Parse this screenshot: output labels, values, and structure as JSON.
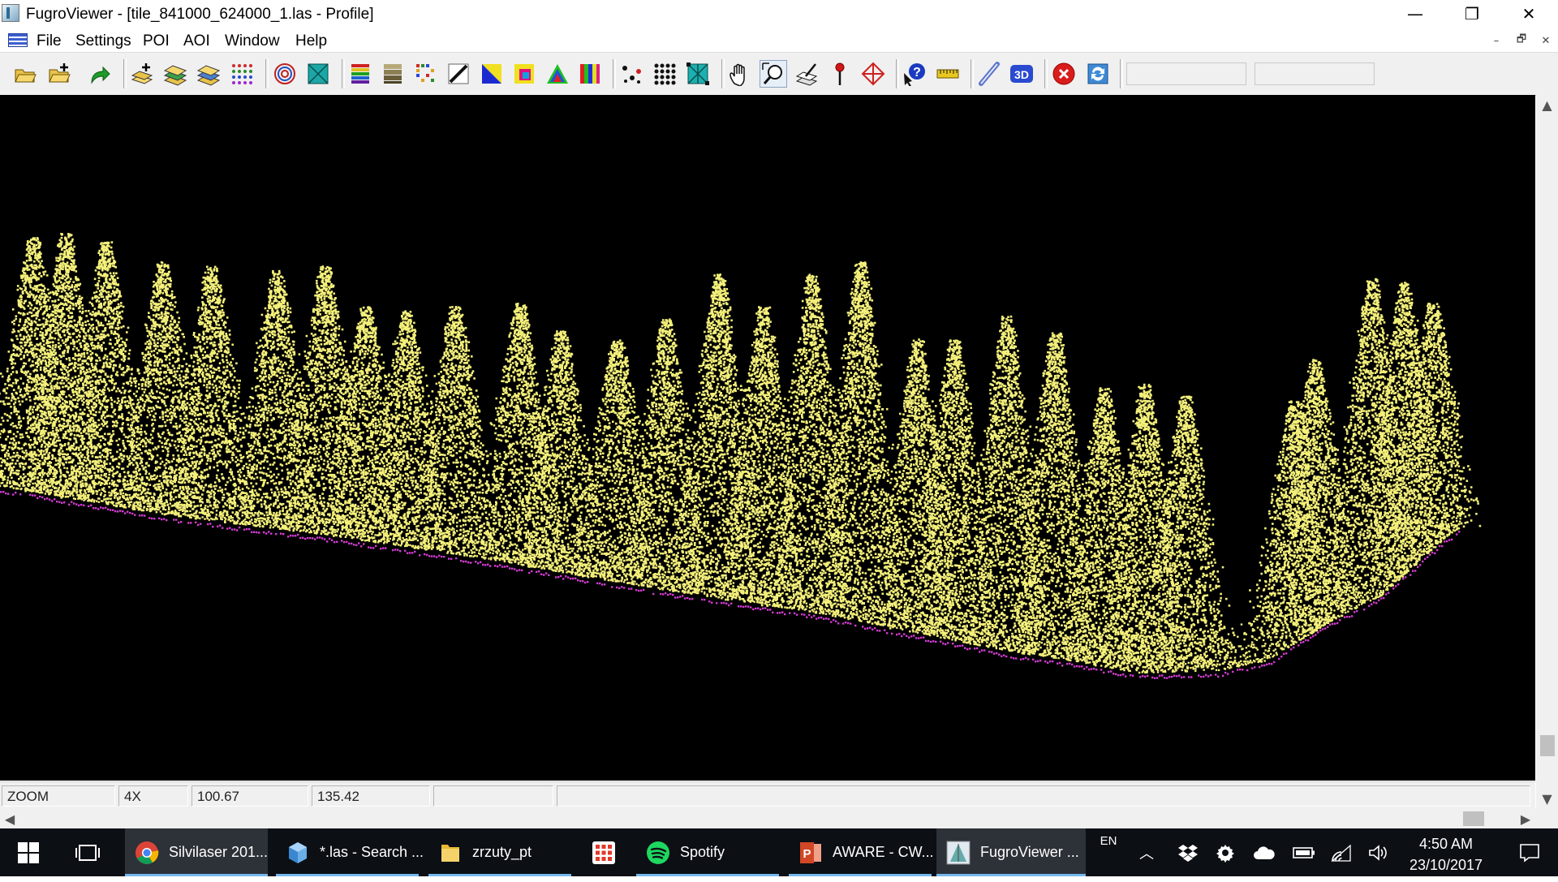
{
  "window": {
    "title": "FugroViewer - [tile_841000_624000_1.las - Profile]",
    "minimize": "—",
    "restore": "❐",
    "close": "✕"
  },
  "menu": {
    "items": [
      "File",
      "Settings",
      "POI",
      "AOI",
      "Window",
      "Help"
    ],
    "mdi_minimize": "–",
    "mdi_restore": "🗗",
    "mdi_close": "✕"
  },
  "toolbar": {
    "buttons": [
      "open-folder-icon",
      "add-layer-folder-icon",
      "redo-arrow-icon",
      "add-layers-icon",
      "layers-icon",
      "layers-filter-icon",
      "point-grid-icon",
      "contours-icon",
      "surface-icon",
      "color-by-elevation-icon",
      "color-by-intensity-icon",
      "color-by-class-icon",
      "slope-icon",
      "blue-yellow-ramp-icon",
      "rgb-color-icon",
      "rainbow-color-icon",
      "spectrum-color-icon",
      "points-icon",
      "dots-grid-icon",
      "tin-icon",
      "pan-hand-icon",
      "zoom-window-icon",
      "profile-icon",
      "poi-pin-icon",
      "target-icon",
      "query-icon",
      "measure-ruler-icon",
      "draw-line-icon",
      "3d-view-icon",
      "stop-icon",
      "refresh-icon"
    ],
    "label_3d": "3D"
  },
  "statusbar": {
    "mode": "ZOOM",
    "zoom": "4X",
    "x": "100.67",
    "y": "135.42",
    "field5": "",
    "field6": ""
  },
  "colors": {
    "canvas_bg": "#000000",
    "vegetation": "#f4f07a",
    "ground": "#d13bd0"
  },
  "taskbar": {
    "apps": [
      {
        "name": "Silvilaser 201...",
        "icon": "chrome-icon"
      },
      {
        "name": "*.las - Search ...",
        "icon": "cube-icon"
      },
      {
        "name": "zrzuty_pt",
        "icon": "folder-icon"
      },
      {
        "name": "",
        "icon": "apps-grid-icon"
      },
      {
        "name": "Spotify",
        "icon": "spotify-icon"
      },
      {
        "name": "AWARE - CW...",
        "icon": "powerpoint-icon"
      },
      {
        "name": "FugroViewer ...",
        "icon": "fugroviewer-icon"
      }
    ],
    "lang": "EN",
    "time": "4:50 AM",
    "date": "23/10/2017"
  }
}
